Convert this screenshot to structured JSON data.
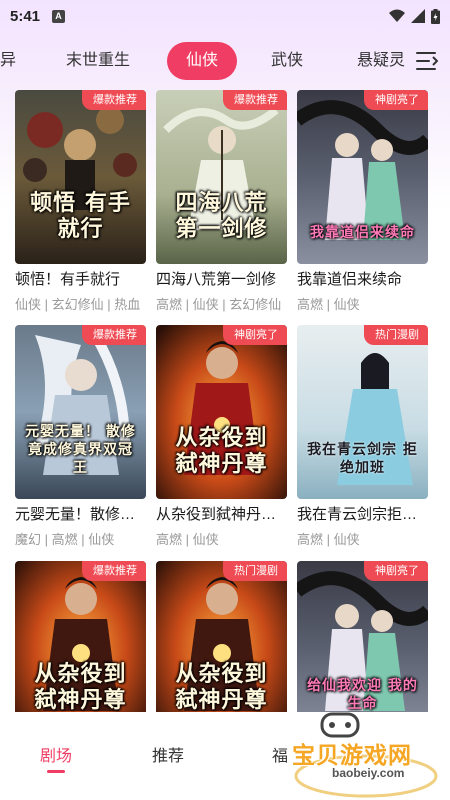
{
  "status": {
    "time": "5:41",
    "notif": "A"
  },
  "categories": {
    "tabs": [
      {
        "label": "异",
        "active": false
      },
      {
        "label": "末世重生",
        "active": false
      },
      {
        "label": "仙侠",
        "active": true
      },
      {
        "label": "武侠",
        "active": false
      },
      {
        "label": "悬疑灵",
        "active": false
      }
    ]
  },
  "books": [
    {
      "title": "顿悟！有手就行",
      "tags": "仙侠 | 玄幻修仙 | 热血",
      "badge": "爆款推荐",
      "cover_text": "顿悟 有手就行"
    },
    {
      "title": "四海八荒第一剑修",
      "tags": "高燃 | 仙侠 | 玄幻修仙",
      "badge": "爆款推荐",
      "cover_text": "四海八荒 第一剑修"
    },
    {
      "title": "我靠道侣来续命",
      "tags": "高燃 | 仙侠",
      "badge": "神剧亮了",
      "cover_text": "我靠道侣来续命"
    },
    {
      "title": "元婴无量！散修…",
      "tags": "魔幻 | 高燃 | 仙侠",
      "badge": "爆款推荐",
      "cover_text": "元婴无量！ 散修竟成修真界双冠王"
    },
    {
      "title": "从杂役到弑神丹…",
      "tags": "高燃 | 仙侠",
      "badge": "神剧亮了",
      "cover_text": "从杂役到 弑神丹尊"
    },
    {
      "title": "我在青云剑宗拒…",
      "tags": "高燃 | 仙侠",
      "badge": "热门漫剧",
      "cover_text": "我在青云剑宗 拒绝加班"
    },
    {
      "title": "",
      "tags": "",
      "badge": "爆款推荐",
      "cover_text": "从杂役到 弑神丹尊"
    },
    {
      "title": "",
      "tags": "",
      "badge": "热门漫剧",
      "cover_text": "从杂役到 弑神丹尊"
    },
    {
      "title": "",
      "tags": "",
      "badge": "神剧亮了",
      "cover_text": "给仙我欢迎 我的生命"
    }
  ],
  "nav": {
    "items": [
      {
        "label": "剧场",
        "active": true
      },
      {
        "label": "推荐",
        "active": false
      },
      {
        "label": "福",
        "active": false
      }
    ]
  },
  "watermark": {
    "text": "宝贝游戏网",
    "url": "baobeiy.com"
  },
  "colors": {
    "accent": "#f03d63",
    "badge": "#ef4b54"
  }
}
